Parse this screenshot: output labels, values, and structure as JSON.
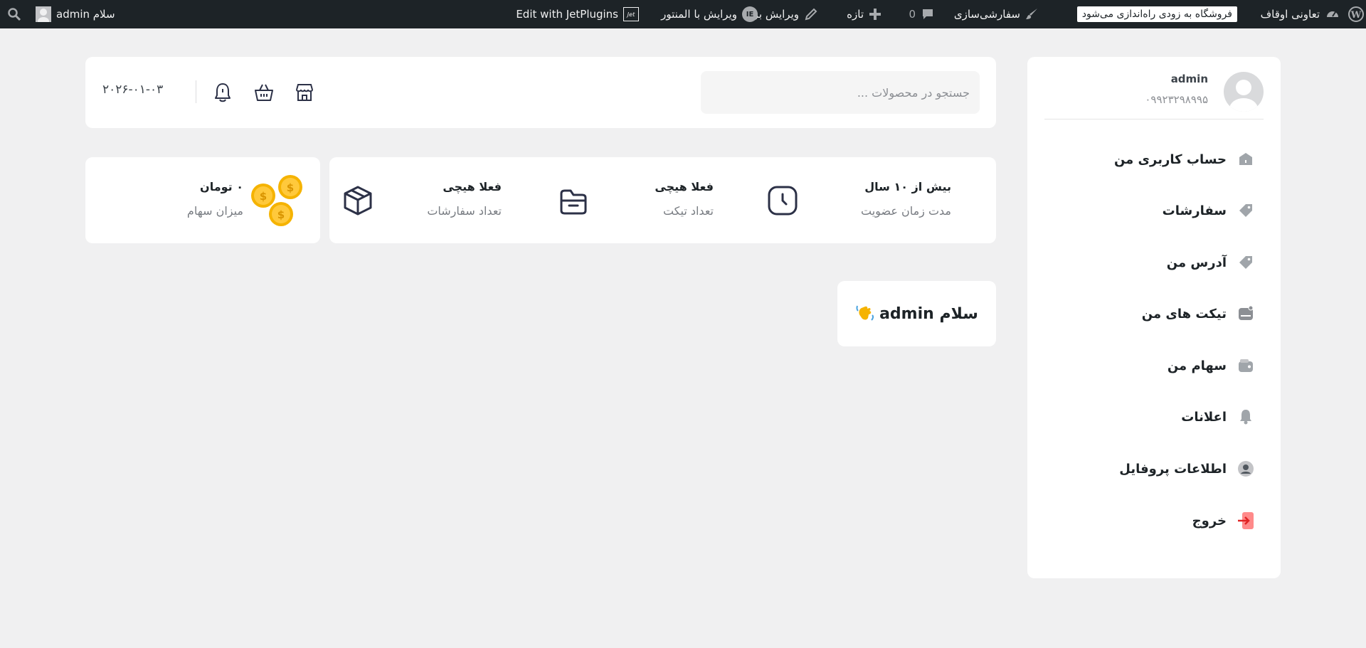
{
  "adminbar": {
    "site_name": "تعاونی اوقاف",
    "notice": "فروشگاه به زودی راه‌اندازی می‌شود",
    "customize": "سفارشی‌سازی",
    "comments_count": "0",
    "new": "تازه",
    "edit_page": "ویرایش برگه",
    "elementor": "ویرایش با المنتور",
    "jet": "Edit with JetPlugins",
    "jet_badge": "Jet",
    "howdy": "سلام admin"
  },
  "profile": {
    "name": "admin",
    "phone": "۰۹۹۲۳۲۹۸۹۹۵"
  },
  "menu": [
    {
      "label": "حساب کاربری من",
      "icon": "home-icon",
      "color": "#a0a5aa"
    },
    {
      "label": "سفارشات",
      "icon": "tag-icon",
      "color": "#a0a5aa"
    },
    {
      "label": "آدرس من",
      "icon": "tag-icon",
      "color": "#a0a5aa"
    },
    {
      "label": "تیکت های من",
      "icon": "tray-icon",
      "color": "#8c8f94"
    },
    {
      "label": "سهام من",
      "icon": "wallet-icon",
      "color": "#a0a5aa"
    },
    {
      "label": "اعلانات",
      "icon": "bell-icon",
      "color": "#a0a5aa"
    },
    {
      "label": "اطلاعات پروفایل",
      "icon": "user-circle-icon",
      "color": "#a0a5aa"
    },
    {
      "label": "خروج",
      "icon": "logout-icon",
      "color": "#ff6b6b"
    }
  ],
  "header": {
    "search_placeholder": "جستجو در محصولات ...",
    "date": "۲۰۲۶-۰۱-۰۳"
  },
  "stats": [
    {
      "value": "بیش از ۱۰ سال",
      "label": "مدت زمان عضویت",
      "icon": "clock-icon"
    },
    {
      "value": "فعلا هیچی",
      "label": "تعداد تیکت",
      "icon": "folder-icon"
    },
    {
      "value": "فعلا هیچی",
      "label": "تعداد سفارشات",
      "icon": "box-icon"
    }
  ],
  "shares": {
    "value": "۰ تومان",
    "label": "میزان سهام",
    "icon": "coins-icon"
  },
  "greeting": "سلام admin",
  "colors": {
    "accent_red": "#ff6b6b",
    "coin": "#f5b301",
    "adminbar": "#1d2327"
  }
}
